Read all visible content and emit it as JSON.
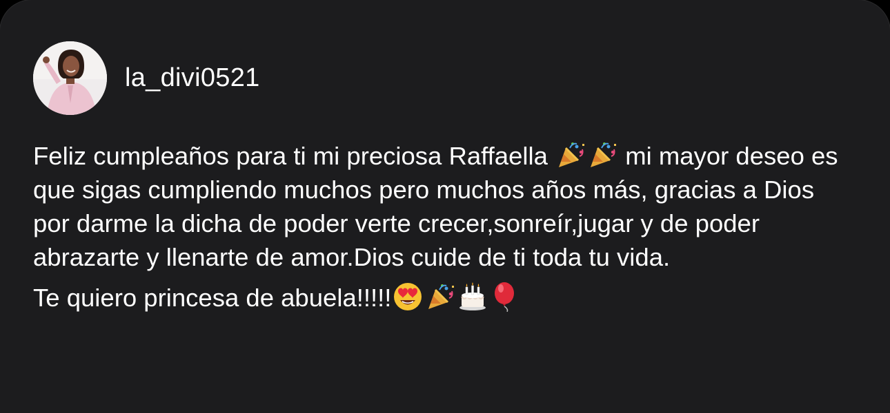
{
  "post": {
    "username": "la_divi0521",
    "avatar_icon": "profile-photo-woman-pink-top",
    "message_line1_before": "Feliz cumpleaños para ti mi preciosa Raffaella",
    "message_line1_after": "mi mayor deseo es que sigas cumpliendo muchos pero muchos años más, gracias a Dios por darme la dicha de poder verte crecer,sonreír,jugar y de poder abrazarte y llenarte de amor.Dios cuide de ti toda tu vida.",
    "message_line2": "Te quiero princesa de abuela!!!!!",
    "emojis_line1": [
      "party-popper-icon",
      "party-popper-icon"
    ],
    "emojis_line2": [
      "heart-eyes-face-icon",
      "party-popper-icon",
      "birthday-cake-icon",
      "red-balloon-icon"
    ]
  },
  "colors": {
    "background": "#1c1c1e",
    "text": "#ffffff"
  }
}
